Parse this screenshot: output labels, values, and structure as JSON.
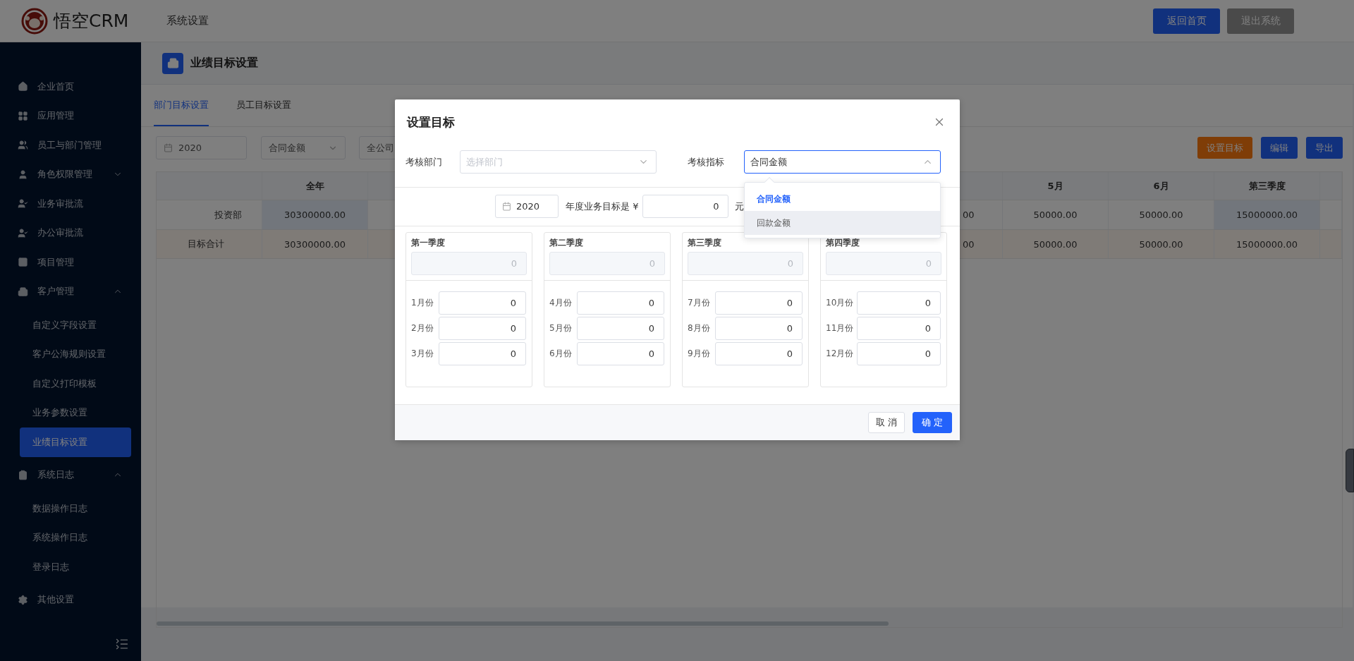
{
  "header": {
    "logo_text": "悟空CRM",
    "title": "系统设置",
    "buttons": [
      {
        "label": "返回首页",
        "disabled": false
      },
      {
        "label": "退出系统",
        "disabled": true
      }
    ]
  },
  "sidebar": {
    "items": [
      {
        "label": "企业首页"
      },
      {
        "label": "应用管理"
      },
      {
        "label": "员工与部门管理"
      },
      {
        "label": "角色权限管理",
        "expanded": false
      },
      {
        "label": "业务审批流"
      },
      {
        "label": "办公审批流"
      },
      {
        "label": "项目管理"
      },
      {
        "label": "客户管理",
        "expanded": true,
        "children": [
          {
            "label": "自定义字段设置",
            "selected": false
          },
          {
            "label": "客户公海规则设置",
            "selected": false
          },
          {
            "label": "自定义打印模板",
            "selected": false
          },
          {
            "label": "业务参数设置",
            "selected": false
          },
          {
            "label": "业绩目标设置",
            "selected": true
          }
        ]
      },
      {
        "label": "系统日志",
        "expanded": true,
        "children": [
          {
            "label": "数据操作日志",
            "selected": false
          },
          {
            "label": "系统操作日志",
            "selected": false
          },
          {
            "label": "登录日志",
            "selected": false
          }
        ]
      },
      {
        "label": "其他设置"
      }
    ]
  },
  "page_header": {
    "title": "业绩目标设置"
  },
  "tabs": [
    {
      "label": "部门目标设置",
      "selected": true
    },
    {
      "label": "员工目标设置",
      "selected": false
    }
  ],
  "toolbar": {
    "year": "2020",
    "metric": "合同金额",
    "scope": "全公司",
    "buttons": [
      {
        "label": "设置目标",
        "kind": "warning"
      },
      {
        "label": "编辑",
        "kind": "primary"
      },
      {
        "label": "导出",
        "kind": "primary"
      }
    ]
  },
  "table": {
    "columns": [
      "全年",
      "5月",
      "6月",
      "第三季度"
    ],
    "rows": [
      {
        "label": "投资部",
        "kind": "department",
        "cut_cell": "00",
        "cells": [
          {
            "text": "30300000.00",
            "highlighted": true
          },
          {
            "text": "50000.00",
            "highlighted": false
          },
          {
            "text": "50000.00",
            "highlighted": false
          },
          {
            "text": "15000000.00",
            "highlighted": true
          }
        ]
      },
      {
        "label": "目标合计",
        "kind": "total",
        "cut_cell": "00",
        "cells": [
          {
            "text": "30300000.00",
            "highlighted": false
          },
          {
            "text": "50000.00",
            "highlighted": false
          },
          {
            "text": "50000.00",
            "highlighted": false
          },
          {
            "text": "15000000.00",
            "highlighted": false
          }
        ]
      }
    ]
  },
  "dialog": {
    "title": "设置目标",
    "fields": [
      {
        "label": "考核部门",
        "placeholder": "选择部门",
        "open": false
      },
      {
        "label": "考核指标",
        "value": "合同金额",
        "open": true
      }
    ],
    "year": "2020",
    "target_label": "年度业务目标是 ¥",
    "target_value": "0",
    "target_unit": "元",
    "quarters": [
      {
        "label": "第一季度",
        "total": "0",
        "months": [
          {
            "label": "1月份",
            "value": "0"
          },
          {
            "label": "2月份",
            "value": "0"
          },
          {
            "label": "3月份",
            "value": "0"
          }
        ]
      },
      {
        "label": "第二季度",
        "total": "0",
        "months": [
          {
            "label": "4月份",
            "value": "0"
          },
          {
            "label": "5月份",
            "value": "0"
          },
          {
            "label": "6月份",
            "value": "0"
          }
        ]
      },
      {
        "label": "第三季度",
        "total": "0",
        "months": [
          {
            "label": "7月份",
            "value": "0"
          },
          {
            "label": "8月份",
            "value": "0"
          },
          {
            "label": "9月份",
            "value": "0"
          }
        ]
      },
      {
        "label": "第四季度",
        "total": "0",
        "months": [
          {
            "label": "10月份",
            "value": "0"
          },
          {
            "label": "11月份",
            "value": "0"
          },
          {
            "label": "12月份",
            "value": "0"
          }
        ]
      }
    ],
    "dropdown": {
      "options": [
        {
          "label": "合同金额",
          "selected": true,
          "hovered": false
        },
        {
          "label": "回款金额",
          "selected": false,
          "hovered": true
        }
      ]
    },
    "buttons": [
      {
        "label": "取 消",
        "kind": "default"
      },
      {
        "label": "确 定",
        "kind": "primary"
      }
    ]
  }
}
